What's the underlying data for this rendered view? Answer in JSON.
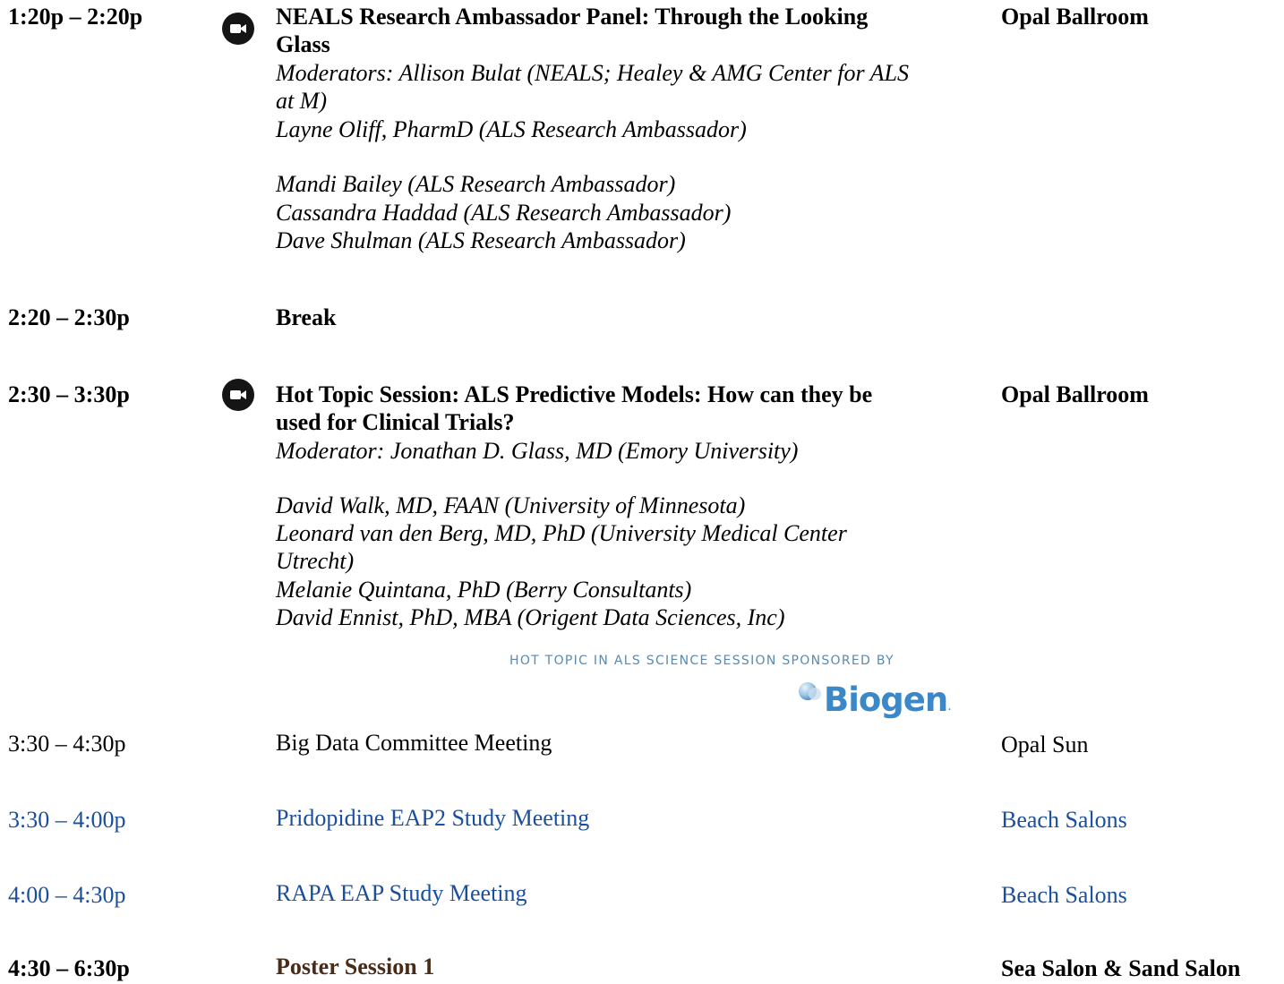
{
  "sessions": [
    {
      "time": "1:20p – 2:20p",
      "title_lines": [
        "NEALS Research Ambassador Panel: Through the Looking",
        "Glass"
      ],
      "room": "Opal Ballroom",
      "icon": "video-camera-icon",
      "people": [
        "Moderators: Allison Bulat (NEALS; Healey & AMG Center for ALS",
        "at M)",
        "Layne Oliff, PharmD (ALS Research Ambassador)",
        "Mandi Bailey (ALS Research Ambassador)",
        "Cassandra Haddad (ALS Research Ambassador)",
        "Dave Shulman (ALS Research Ambassador)"
      ]
    },
    {
      "time": "2:20 – 2:30p",
      "title": "Break"
    },
    {
      "time": "2:30 – 3:30p",
      "title_lines": [
        "Hot Topic Session: ALS Predictive Models: How can they be",
        "used for Clinical Trials?"
      ],
      "room": "Opal Ballroom",
      "icon": "video-camera-icon",
      "people": [
        "Moderator: Jonathan D. Glass, MD (Emory University)",
        "David Walk, MD, FAAN (University of Minnesota)",
        "Leonard van den Berg, MD, PhD (University Medical Center",
        "Utrecht)",
        "Melanie Quintana, PhD (Berry Consultants)",
        "David Ennist, PhD, MBA (Origent Data Sciences, Inc)"
      ],
      "sponsor_text": "HOT TOPIC IN ALS SCIENCE SESSION  SPONSORED BY",
      "sponsor_logo": "Biogen"
    },
    {
      "time": "3:30 – 4:30p",
      "title": "Big Data Committee Meeting",
      "room": "Opal Sun"
    },
    {
      "time": "3:30 – 4:00p",
      "title": "Pridopidine EAP2 Study Meeting",
      "room": "Beach Salons"
    },
    {
      "time": "4:00 – 4:30p",
      "title": "RAPA EAP Study Meeting",
      "room": "Beach Salons"
    },
    {
      "time": "4:30 – 6:30p",
      "title": "Poster Session 1",
      "room": "Sea Salon & Sand Salon"
    }
  ],
  "colors": {
    "link_blue": "#1a4fa0",
    "poster_brown": "#4a2b17",
    "sponsor_blue": "#5a8ab0",
    "biogen_blue": "#3a88c8"
  }
}
